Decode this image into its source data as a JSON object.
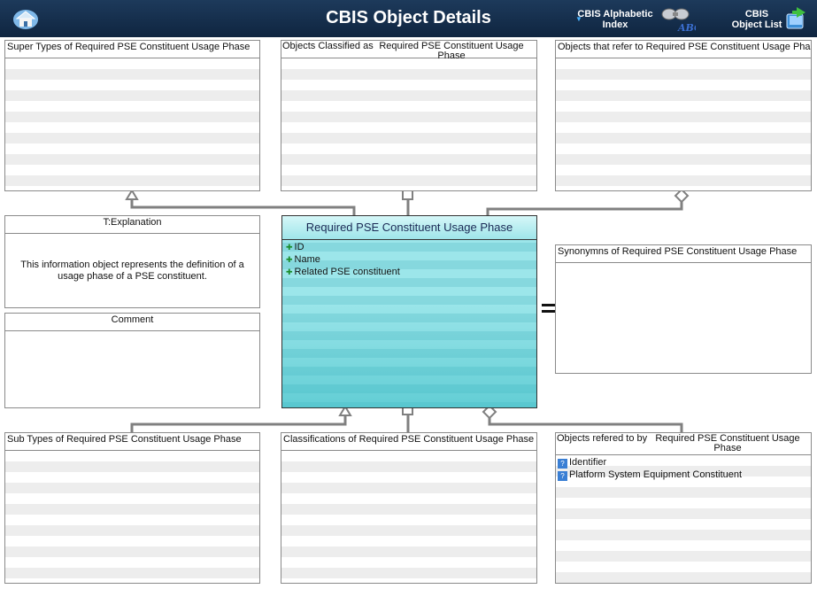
{
  "header": {
    "title": "CBIS Object Details",
    "home_icon": "home-icon",
    "alpha_line1": "CBIS Alphabetic",
    "alpha_line2": "Index",
    "alpha_icon": "binoculars-abc-icon",
    "list_line1": "CBIS",
    "list_line2": "Object List",
    "list_icon": "book-arrow-icon"
  },
  "panels": {
    "super_types": "Super Types of Required PSE Constituent Usage Phase",
    "classified_prefix": "Objects Classified as",
    "classified_name": "Required PSE Constituent Usage Phase",
    "refer_to": "Objects that refer to   Required PSE Constituent Usage Phase",
    "explanation_title": "T:Explanation",
    "explanation_text": "This information object represents the definition of a usage phase of a PSE constituent.",
    "comment_title": "Comment",
    "synonyms": "Synonymns  of Required PSE Constituent Usage Phase",
    "sub_types": "Sub Types of Required PSE Constituent Usage Phase",
    "classifications": "Classifications of Required PSE Constituent Usage Phase",
    "referred_prefix": "Objects refered to by",
    "referred_name": "Required PSE Constituent Usage Phase",
    "referred_items": [
      "Identifier",
      "Platform System Equipment Constituent"
    ]
  },
  "center": {
    "title": "Required PSE Constituent Usage Phase",
    "attributes": [
      "ID",
      "Name",
      "Related PSE constituent"
    ]
  },
  "colors": {
    "header_bg": "#0f2540",
    "entity_fill": "#9ce6ea",
    "connector": "#808080"
  }
}
